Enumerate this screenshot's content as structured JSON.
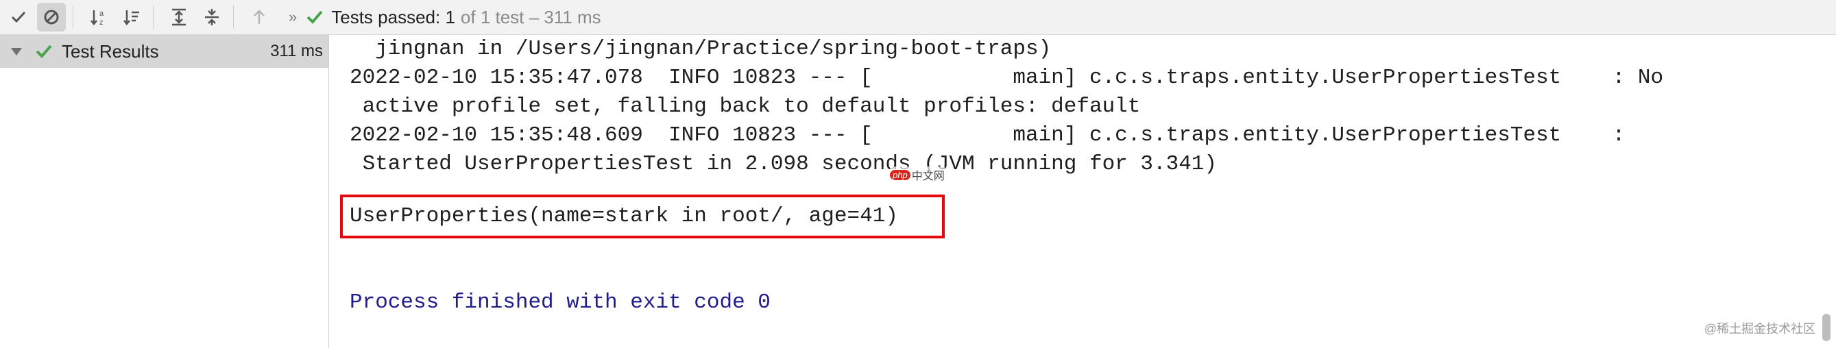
{
  "toolbar": {
    "buttons": [
      {
        "name": "show-passed-button",
        "icon": "checkmark-icon"
      },
      {
        "name": "show-ignored-button",
        "icon": "ignored-icon"
      },
      {
        "name": "sort-alphabetically-button",
        "icon": "sort-alpha-icon"
      },
      {
        "name": "sort-by-duration-button",
        "icon": "sort-duration-icon"
      },
      {
        "name": "expand-all-button",
        "icon": "expand-all-icon"
      },
      {
        "name": "collapse-all-button",
        "icon": "collapse-all-icon"
      },
      {
        "name": "previous-failed-button",
        "icon": "up-arrow-icon"
      }
    ],
    "more": "»",
    "status": {
      "passed": "Tests passed: 1",
      "of": "of 1 test – 311 ms"
    }
  },
  "tree": {
    "root": {
      "label": "Test Results",
      "duration": "311 ms"
    }
  },
  "console": {
    "lines": [
      "  jingnan in /Users/jingnan/Practice/spring-boot-traps)",
      "2022-02-10 15:35:47.078  INFO 10823 --- [           main] c.c.s.traps.entity.UserPropertiesTest    : No",
      " active profile set, falling back to default profiles: default",
      "2022-02-10 15:35:48.609  INFO 10823 --- [           main] c.c.s.traps.entity.UserPropertiesTest    :",
      " Started UserPropertiesTest in 2.098 seconds (JVM running for 3.341)"
    ],
    "highlighted": "UserProperties(name=stark in root/, age=41)",
    "process": "Process finished with exit code 0"
  },
  "watermarks": {
    "php_logo": "php",
    "php_text": "中文网",
    "bottom": "@稀土掘金技术社区"
  },
  "colors": {
    "pass_green": "#4aa34a",
    "highlight_red": "#e8060e",
    "process_blue": "#1f1c8c"
  }
}
